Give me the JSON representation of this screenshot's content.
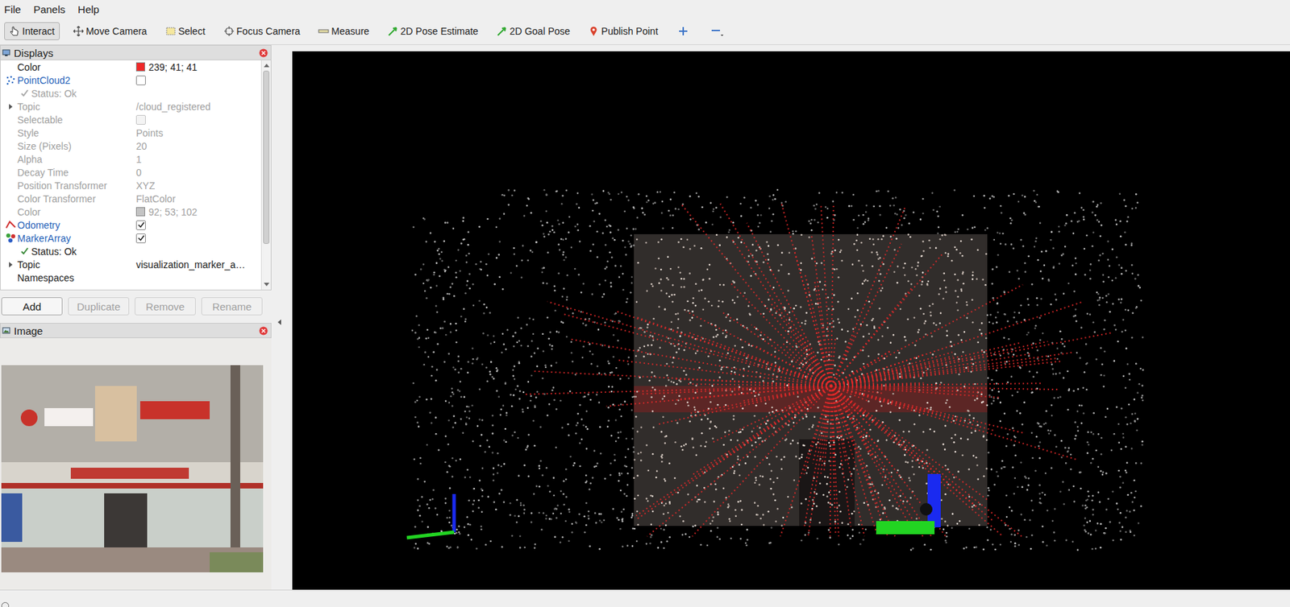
{
  "menu": [
    {
      "label": "File"
    },
    {
      "label": "Panels"
    },
    {
      "label": "Help"
    }
  ],
  "tools": [
    {
      "label": "Interact",
      "kind": "interact",
      "selected": true
    },
    {
      "label": "Move Camera",
      "kind": "move",
      "selected": false
    },
    {
      "label": "Select",
      "kind": "select",
      "selected": false
    },
    {
      "label": "Focus Camera",
      "kind": "focus",
      "selected": false
    },
    {
      "label": "Measure",
      "kind": "measure",
      "selected": false
    },
    {
      "label": "2D Pose Estimate",
      "kind": "pose",
      "selected": false
    },
    {
      "label": "2D Goal Pose",
      "kind": "goal",
      "selected": false
    },
    {
      "label": "Publish Point",
      "kind": "point",
      "selected": false
    }
  ],
  "tool_actions": [
    {
      "kind": "add"
    },
    {
      "kind": "remove"
    }
  ],
  "displays": {
    "title": "Displays",
    "scroll_level": 0.83,
    "rows": [
      {
        "kind": "property",
        "name": "Color",
        "value": "239; 41; 41",
        "color": "#ef2929",
        "disabled": false
      },
      {
        "kind": "pointcloud",
        "name": "PointCloud2",
        "checked": false,
        "disabled": false
      },
      {
        "kind": "status",
        "name": "Status: Ok",
        "disabled": true
      },
      {
        "kind": "group",
        "name": "Topic",
        "value": "/cloud_registered",
        "expanded": false,
        "disabled": true
      },
      {
        "kind": "property",
        "name": "Selectable",
        "checked": false,
        "disabled": true
      },
      {
        "kind": "property",
        "name": "Style",
        "value": "Points",
        "disabled": true
      },
      {
        "kind": "property",
        "name": "Size (Pixels)",
        "value": "20",
        "disabled": true
      },
      {
        "kind": "property",
        "name": "Alpha",
        "value": "1",
        "disabled": true
      },
      {
        "kind": "property",
        "name": "Decay Time",
        "value": "0",
        "disabled": true
      },
      {
        "kind": "property",
        "name": "Position Transformer",
        "value": "XYZ",
        "disabled": true
      },
      {
        "kind": "property",
        "name": "Color Transformer",
        "value": "FlatColor",
        "disabled": true
      },
      {
        "kind": "property",
        "name": "Color",
        "value": "92; 53; 102",
        "color": "#c4c4c4",
        "disabled": true
      },
      {
        "kind": "odometry",
        "name": "Odometry",
        "checked": true,
        "disabled": false
      },
      {
        "kind": "markerarray",
        "name": "MarkerArray",
        "checked": true,
        "disabled": false
      },
      {
        "kind": "status",
        "name": "Status: Ok",
        "disabled": false
      },
      {
        "kind": "group",
        "name": "Topic",
        "value": "visualization_marker_a…",
        "expanded": false,
        "disabled": false
      },
      {
        "kind": "property",
        "name": "Namespaces",
        "disabled": false
      }
    ]
  },
  "panel_buttons": [
    {
      "label": "Add",
      "disabled": false
    },
    {
      "label": "Duplicate",
      "disabled": true
    },
    {
      "label": "Remove",
      "disabled": true
    },
    {
      "label": "Rename",
      "disabled": true
    }
  ],
  "image_panel": {
    "title": "Image"
  }
}
